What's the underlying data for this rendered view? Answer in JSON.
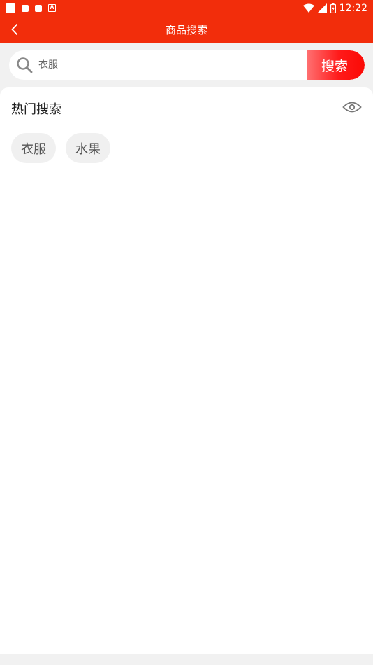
{
  "status_bar": {
    "time": "12:22",
    "icons": [
      "notification-icon",
      "sim-icon",
      "sim-icon",
      "font-icon",
      "wifi-icon",
      "signal-icon",
      "battery-icon"
    ]
  },
  "nav": {
    "title": "商品搜索",
    "back_icon": "chevron-left-icon"
  },
  "search": {
    "value": "",
    "placeholder": "衣服",
    "button_label": "搜索",
    "icon": "search-icon"
  },
  "hot_search": {
    "title": "热门搜索",
    "eye_icon": "eye-icon",
    "tags": [
      {
        "label": "衣服"
      },
      {
        "label": "水果"
      }
    ]
  },
  "colors": {
    "primary": "#f22d0b",
    "button_gradient_start": "#ff6f70",
    "button_gradient_end": "#fb0a05",
    "background": "#f1f1f1"
  }
}
